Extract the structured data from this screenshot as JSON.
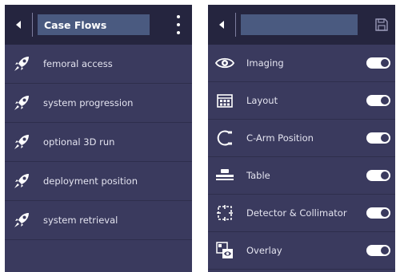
{
  "left_panel": {
    "title": "Case Flows",
    "items": [
      {
        "label": "femoral access",
        "icon": "rocket-icon"
      },
      {
        "label": "system progression",
        "icon": "rocket-icon"
      },
      {
        "label": "optional 3D run",
        "icon": "rocket-icon"
      },
      {
        "label": "deployment position",
        "icon": "rocket-icon"
      },
      {
        "label": "system retrieval",
        "icon": "rocket-icon"
      }
    ]
  },
  "right_panel": {
    "title": "",
    "items": [
      {
        "label": "Imaging",
        "icon": "eye-icon",
        "enabled": true
      },
      {
        "label": "Layout",
        "icon": "layout-grid-icon",
        "enabled": true
      },
      {
        "label": "C-Arm Position",
        "icon": "c-arm-icon",
        "enabled": true
      },
      {
        "label": "Table",
        "icon": "table-icon",
        "enabled": true
      },
      {
        "label": "Detector & Collimator",
        "icon": "detector-collimator-icon",
        "enabled": true
      },
      {
        "label": "Overlay",
        "icon": "overlay-icon",
        "enabled": true
      }
    ]
  },
  "colors": {
    "panel_bg": "#3a3a5e",
    "header_bg": "#25253f",
    "title_box_bg": "#4a5a80",
    "text": "#e4e4f0",
    "toggle_on": "#ffffff"
  }
}
